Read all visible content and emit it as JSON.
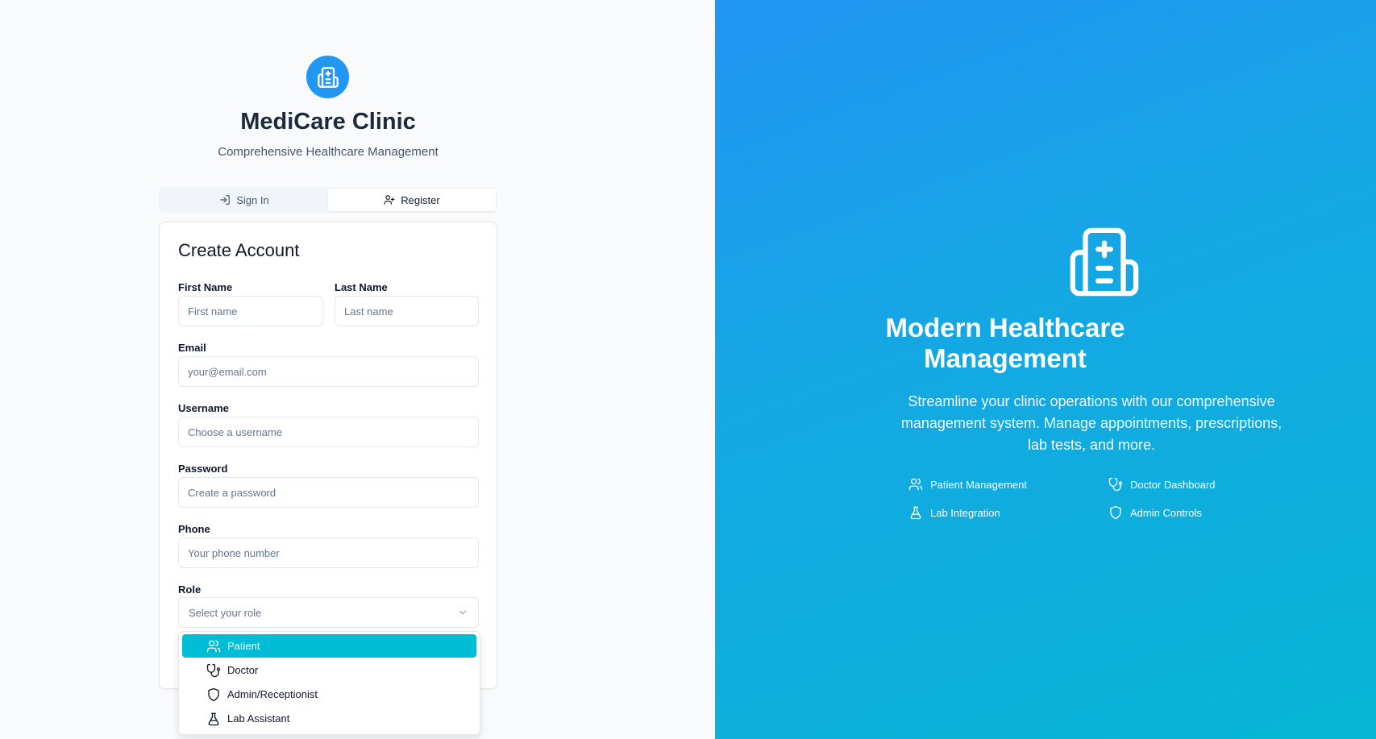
{
  "brand": {
    "title": "MediCare Clinic",
    "subtitle": "Comprehensive Healthcare Management",
    "accent_color": "#2196f3"
  },
  "tabs": [
    {
      "label": "Sign In",
      "icon": "log-in-icon",
      "active": false
    },
    {
      "label": "Register",
      "icon": "user-plus-icon",
      "active": true
    }
  ],
  "form": {
    "title": "Create Account",
    "first_name": {
      "label": "First Name",
      "placeholder": "First name"
    },
    "last_name": {
      "label": "Last Name",
      "placeholder": "Last name"
    },
    "email": {
      "label": "Email",
      "placeholder": "your@email.com"
    },
    "username": {
      "label": "Username",
      "placeholder": "Choose a username"
    },
    "password": {
      "label": "Password",
      "placeholder": "Create a password"
    },
    "phone": {
      "label": "Phone",
      "placeholder": "Your phone number"
    },
    "role": {
      "label": "Role",
      "placeholder": "Select your role",
      "options": [
        {
          "label": "Patient",
          "icon": "users-icon",
          "highlighted": true
        },
        {
          "label": "Doctor",
          "icon": "stethoscope-icon",
          "highlighted": false
        },
        {
          "label": "Admin/Receptionist",
          "icon": "shield-icon",
          "highlighted": false
        },
        {
          "label": "Lab Assistant",
          "icon": "flask-icon",
          "highlighted": false
        }
      ],
      "highlight_color": "#00bcd4"
    }
  },
  "hero": {
    "title_line1": "Modern Healthcare",
    "title_line2": "Management",
    "text": "Streamline your clinic operations with our comprehensive management system. Manage appointments, prescriptions, lab tests, and more.",
    "features": [
      {
        "label": "Patient Management",
        "icon": "users-icon"
      },
      {
        "label": "Doctor Dashboard",
        "icon": "stethoscope-icon"
      },
      {
        "label": "Lab Integration",
        "icon": "flask-icon"
      },
      {
        "label": "Admin Controls",
        "icon": "shield-icon"
      }
    ],
    "gradient_start": "#2196f3",
    "gradient_end": "#06b6d4"
  }
}
